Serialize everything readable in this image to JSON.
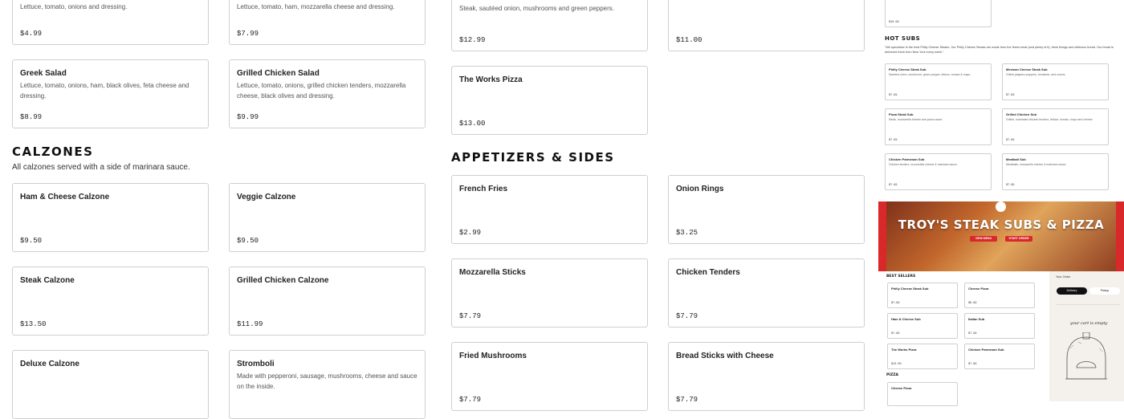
{
  "top_cards": [
    {
      "name": "",
      "desc": "Lettuce, tomato, onions and dressing.",
      "price": "$4.99"
    },
    {
      "name": "",
      "desc": "Lettuce, tomato, ham, mozzarella cheese and dressing.",
      "price": "$7.99"
    },
    {
      "name": "",
      "desc": "Steak, sautéed onion, mushrooms and green peppers.",
      "price": "$12.99"
    },
    {
      "name": "",
      "desc": "",
      "price": "$11.00"
    }
  ],
  "salads": [
    {
      "name": "Greek Salad",
      "desc": "Lettuce, tomato, onions, ham, black olives, feta cheese and dressing.",
      "price": "$8.99"
    },
    {
      "name": "Grilled Chicken Salad",
      "desc": "Lettuce, tomato, onions, grilled chicken tenders, mozzarella cheese, black olives and dressing.",
      "price": "$9.99"
    }
  ],
  "works_pizza": {
    "name": "The Works Pizza",
    "price": "$13.00"
  },
  "calzones": {
    "title": "CALZONES",
    "subtitle": "All calzones served with a side of marinara sauce.",
    "items": [
      {
        "name": "Ham & Cheese Calzone",
        "desc": "",
        "price": "$9.50"
      },
      {
        "name": "Veggie Calzone",
        "desc": "",
        "price": "$9.50"
      },
      {
        "name": "Steak Calzone",
        "desc": "",
        "price": "$13.50"
      },
      {
        "name": "Grilled Chicken Calzone",
        "desc": "",
        "price": "$11.99"
      },
      {
        "name": "Deluxe Calzone",
        "desc": "",
        "price": ""
      },
      {
        "name": "Stromboli",
        "desc": "Made with pepperoni, sausage, mushrooms, cheese and sauce on the inside.",
        "price": ""
      }
    ]
  },
  "appetizers": {
    "title": "APPETIZERS & SIDES",
    "items": [
      {
        "name": "French Fries",
        "price": "$2.99"
      },
      {
        "name": "Onion Rings",
        "price": "$3.25"
      },
      {
        "name": "Mozzarella Sticks",
        "price": "$7.79"
      },
      {
        "name": "Chicken Tenders",
        "price": "$7.79"
      },
      {
        "name": "Fried Mushrooms",
        "price": "$7.79"
      },
      {
        "name": "Bread Sticks with Cheese",
        "price": "$7.79"
      }
    ]
  },
  "preview": {
    "top_price": "$10.99",
    "hot_subs_title": "HOT SUBS",
    "hot_subs_desc": "\"We specialize in the best Philly Cheese Steaks. Our Philly Cheese Steaks are made from the finest meat (and plenty of it), fresh fixings and delicious bread. Our bread is delivered fresh from New York every week.\"",
    "subs": [
      {
        "name": "Philly Cheese Steak Sub",
        "desc": "Sautéed onion, mushroom, green pepper, lettuce, tomato & mayo.",
        "price": "$7.99"
      },
      {
        "name": "Mexican Cheese Steak Sub",
        "desc": "Grilled jalapeno peppers, tomatoes, and onions.",
        "price": "$7.99"
      },
      {
        "name": "Pizza Steak Sub",
        "desc": "Steak, mozzarella cheese and pizza sauce.",
        "price": "$7.99"
      },
      {
        "name": "Grilled Chicken Sub",
        "desc": "Grilled, marinated chicken tenders, lettuce, tomato, mayo and cheese.",
        "price": "$7.99"
      },
      {
        "name": "Chicken Parmesan Sub",
        "desc": "Chicken tenders, mozzarella cheese & marinara sauce.",
        "price": "$7.99"
      },
      {
        "name": "Meatball Sub",
        "desc": "Meatballs, mozzarella cheese & marinara sauce.",
        "price": "$7.99"
      }
    ],
    "hero_title": "TROY'S STEAK SUBS & PIZZA",
    "hero_btn_menu": "VIEW MENU",
    "hero_btn_order": "START ORDER",
    "best_sellers_title": "BEST SELLERS",
    "pizza_title": "PIZZA",
    "order_title": "Your Order",
    "order_delivery": "Delivery",
    "order_pickup": "Pickup",
    "cart_empty": "your cart is empty",
    "best_sellers": [
      {
        "name": "Philly Cheese Steak Sub",
        "price": "$7.99"
      },
      {
        "name": "Cheese Pizza",
        "price": "$6.99"
      },
      {
        "name": "Ham & Cheese Sub",
        "price": "$7.99"
      },
      {
        "name": "Italian Sub",
        "price": "$7.99"
      },
      {
        "name": "The Works Pizza",
        "price": "$13.00"
      },
      {
        "name": "Chicken Parmesan Sub",
        "price": "$7.99"
      }
    ],
    "pizza_item": {
      "name": "Cheese Pizza",
      "price": ""
    }
  }
}
